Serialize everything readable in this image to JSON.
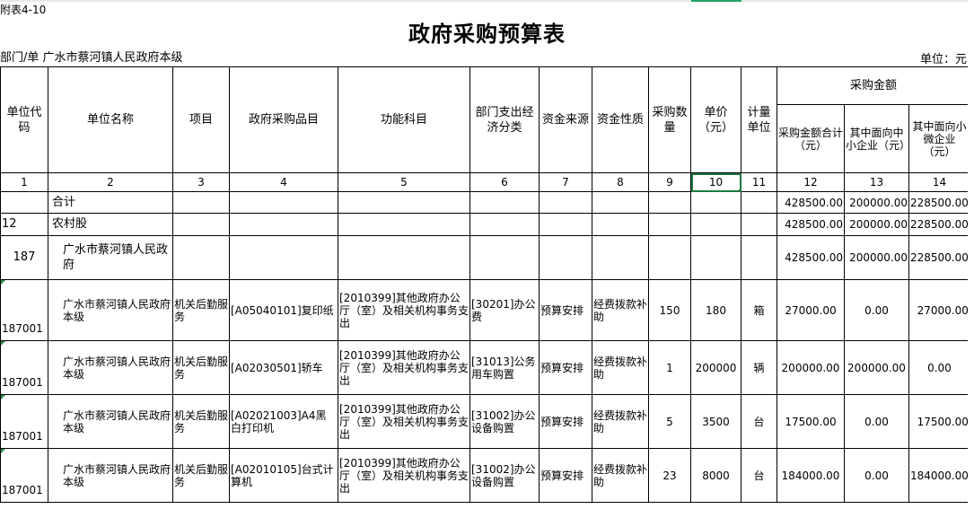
{
  "doc": {
    "corner_label": "附表4-10",
    "title": "政府采购预算表",
    "dept_label": "部门/单",
    "dept_name": "广水市蔡河镇人民政府本级",
    "unit_label": "单位：元"
  },
  "headers": {
    "c1": "单位代码",
    "c2": "单位名称",
    "c3": "项目",
    "c4": "政府采购品目",
    "c5": "功能科目",
    "c6": "部门支出经济分类",
    "c7": "资金来源",
    "c8": "资金性质",
    "c9": "采购数量",
    "c10": "单价（元）",
    "c11": "计量单位",
    "group": "采购金额",
    "c12": "采购金额合计（元）",
    "c13": "其中面向中小企业（元）",
    "c14": "其中面向小微企业（元）"
  },
  "col_numbers": [
    "1",
    "2",
    "3",
    "4",
    "5",
    "6",
    "7",
    "8",
    "9",
    "10",
    "11",
    "12",
    "13",
    "14"
  ],
  "summary_rows": [
    {
      "code": "",
      "name": "合计",
      "total": "428500.00",
      "sme": "200000.00",
      "micro": "228500.00"
    },
    {
      "code": "12",
      "name": "农村股",
      "total": "428500.00",
      "sme": "200000.00",
      "micro": "228500.00"
    },
    {
      "code": "187",
      "name": "广水市蔡河镇人民政府",
      "total": "428500.00",
      "sme": "200000.00",
      "micro": "228500.00"
    }
  ],
  "rows": [
    {
      "code": "187001",
      "name": "广水市蔡河镇人民政府本级",
      "project": "机关后勤服务",
      "item": "[A05040101]复印纸",
      "func": "[2010399]其他政府办公厅（室）及相关机构事务支出",
      "econ": "[30201]办公费",
      "source": "预算安排",
      "nature": "经费拨款补助",
      "qty": "150",
      "price": "180",
      "unit": "箱",
      "total": "27000.00",
      "sme": "0.00",
      "micro": "27000.00"
    },
    {
      "code": "187001",
      "name": "广水市蔡河镇人民政府本级",
      "project": "机关后勤服务",
      "item": "[A02030501]轿车",
      "func": "[2010399]其他政府办公厅（室）及相关机构事务支出",
      "econ": "[31013]公务用车购置",
      "source": "预算安排",
      "nature": "经费拨款补助",
      "qty": "1",
      "price": "200000",
      "unit": "辆",
      "total": "200000.00",
      "sme": "200000.00",
      "micro": "0.00"
    },
    {
      "code": "187001",
      "name": "广水市蔡河镇人民政府本级",
      "project": "机关后勤服务",
      "item": "[A02021003]A4黑白打印机",
      "func": "[2010399]其他政府办公厅（室）及相关机构事务支出",
      "econ": "[31002]办公设备购置",
      "source": "预算安排",
      "nature": "经费拨款补助",
      "qty": "5",
      "price": "3500",
      "unit": "台",
      "total": "17500.00",
      "sme": "0.00",
      "micro": "17500.00"
    },
    {
      "code": "187001",
      "name": "广水市蔡河镇人民政府本级",
      "project": "机关后勤服务",
      "item": "[A02010105]台式计算机",
      "func": "[2010399]其他政府办公厅（室）及相关机构事务支出",
      "econ": "[31002]办公设备购置",
      "source": "预算安排",
      "nature": "经费拨款补助",
      "qty": "23",
      "price": "8000",
      "unit": "台",
      "total": "184000.00",
      "sme": "0.00",
      "micro": "184000.00"
    }
  ]
}
